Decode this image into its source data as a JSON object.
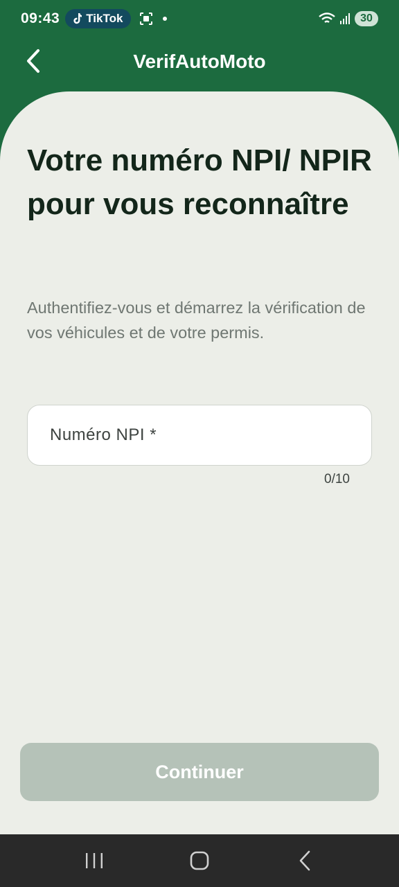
{
  "status_bar": {
    "time": "09:43",
    "tiktok_label": "TikTok",
    "battery": "30"
  },
  "app_bar": {
    "title": "VerifAutoMoto",
    "back_icon": "chevron-left-icon"
  },
  "content": {
    "heading": "Votre numéro NPI/ NPIR pour vous reconnaître",
    "subtitle": "Authentifiez-vous et démarrez la vérification de vos véhicules et de votre permis.",
    "npi_field": {
      "placeholder": "Numéro NPI *",
      "value": "",
      "counter": "0/10"
    },
    "continue_label": "Continuer"
  },
  "nav_bar": {
    "items": [
      "recent-apps-icon",
      "home-icon",
      "back-icon"
    ]
  },
  "colors": {
    "brand_green": "#1c6b3f",
    "sheet_bg": "#eceee8",
    "button_disabled": "#b5c2b8",
    "nav_bg": "#292929"
  }
}
